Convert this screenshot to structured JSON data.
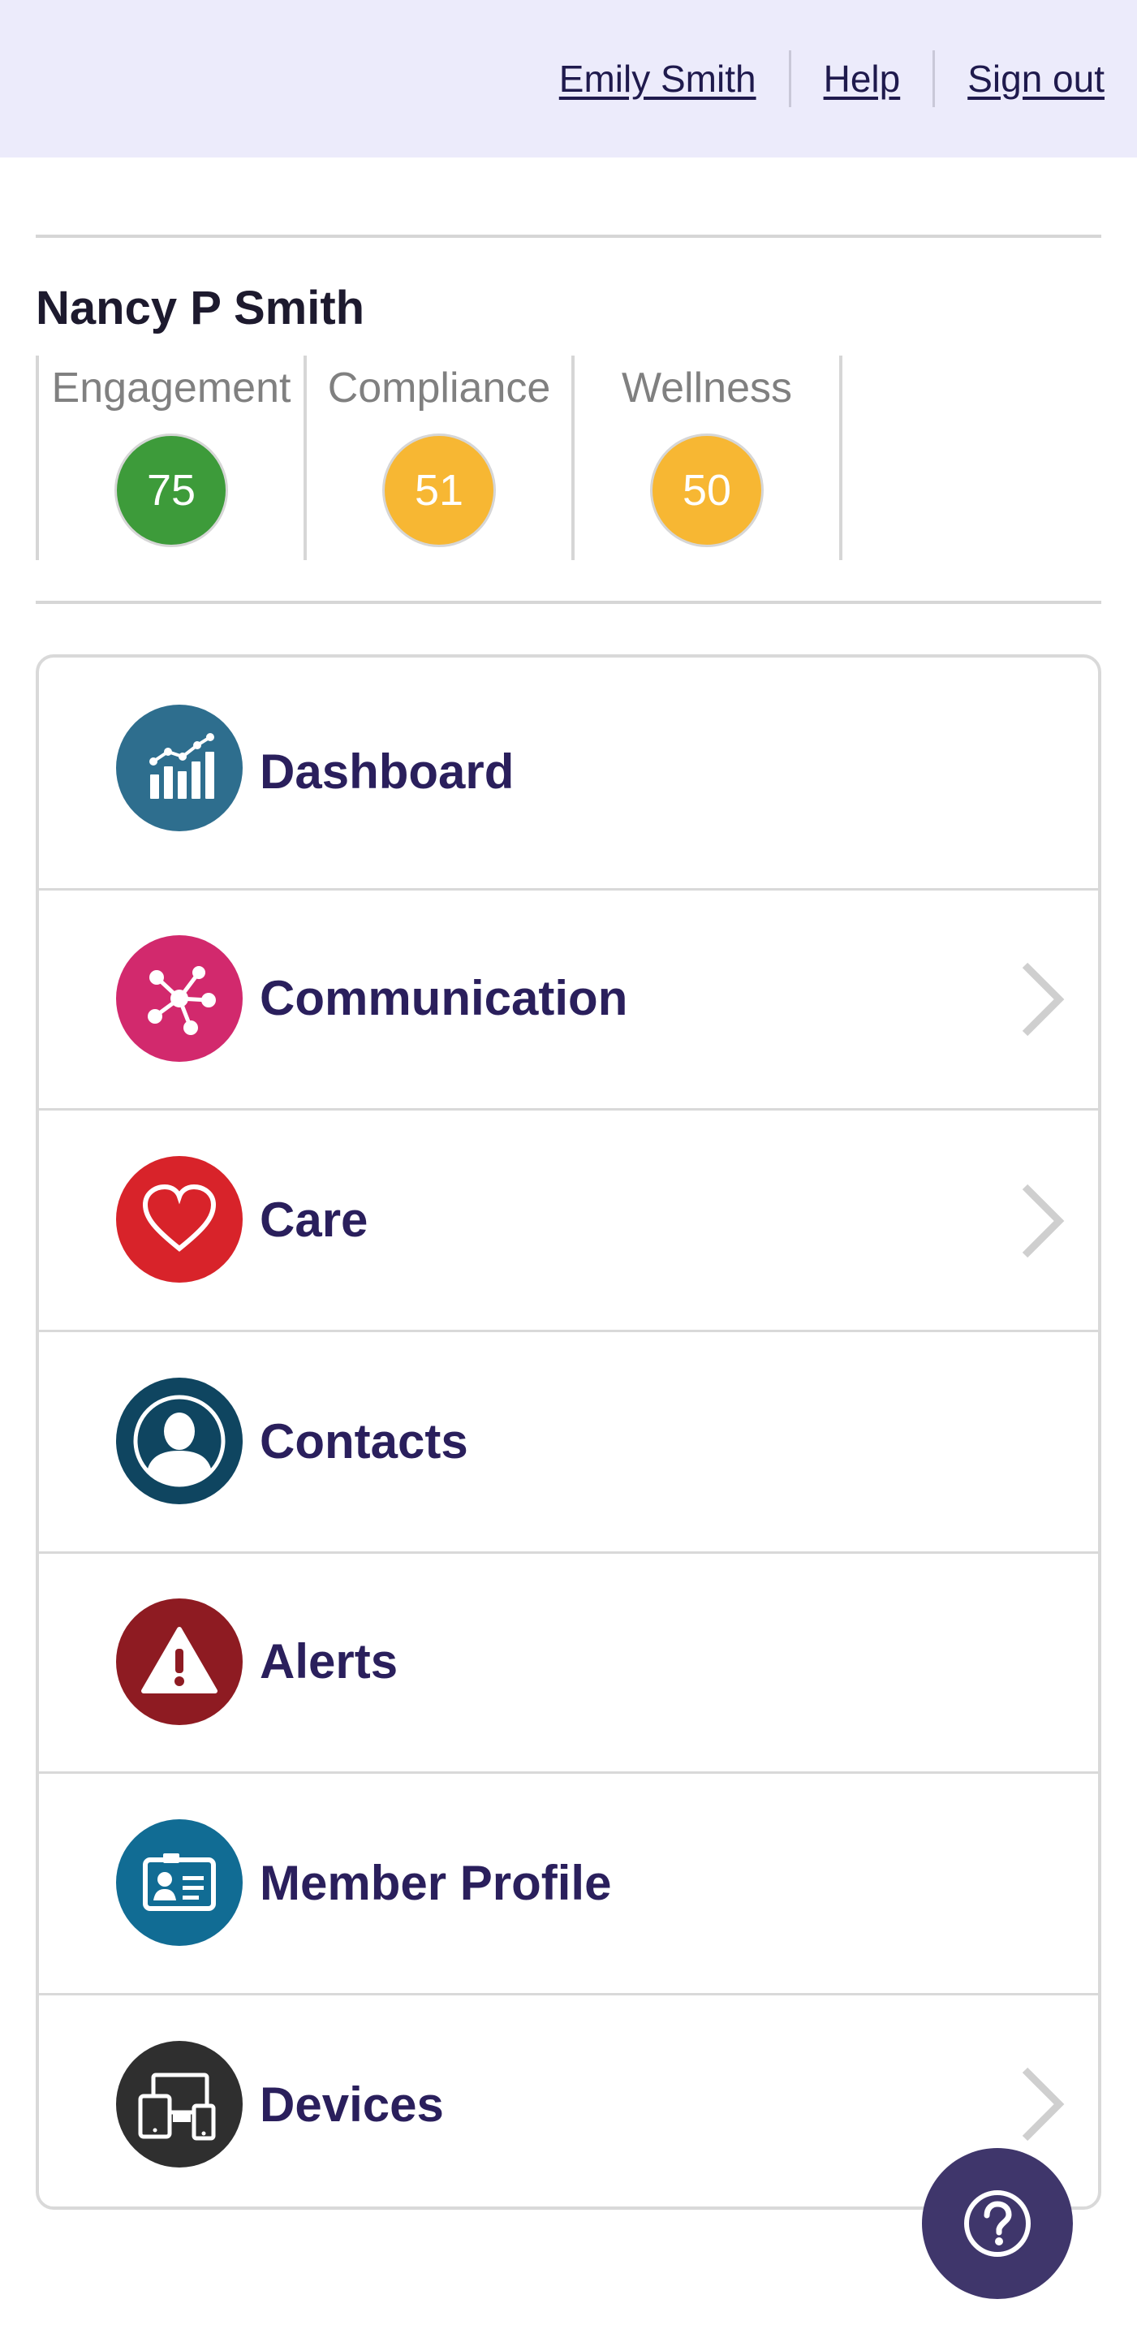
{
  "header": {
    "user_link": "Emily Smith",
    "help_link": "Help",
    "signout_link": "Sign out"
  },
  "member": {
    "name": "Nancy P Smith"
  },
  "scores": [
    {
      "label": "Engagement",
      "value": "75",
      "color": "#3d9b3a"
    },
    {
      "label": "Compliance",
      "value": "51",
      "color": "#f7b733"
    },
    {
      "label": "Wellness",
      "value": "50",
      "color": "#f7b733"
    }
  ],
  "menu": [
    {
      "label": "Dashboard",
      "icon": "dashboard-chart-icon",
      "color": "#2e6e8e",
      "has_chevron": false
    },
    {
      "label": "Communication",
      "icon": "network-hub-icon",
      "color": "#d2296d",
      "has_chevron": true
    },
    {
      "label": "Care",
      "icon": "heart-icon",
      "color": "#d8232a",
      "has_chevron": true
    },
    {
      "label": "Contacts",
      "icon": "person-icon",
      "color": "#0f4560",
      "has_chevron": false
    },
    {
      "label": "Alerts",
      "icon": "warning-triangle-icon",
      "color": "#8e1b22",
      "has_chevron": false
    },
    {
      "label": "Member Profile",
      "icon": "id-card-icon",
      "color": "#116c94",
      "has_chevron": false
    },
    {
      "label": "Devices",
      "icon": "devices-icon",
      "color": "#2f2f2f",
      "has_chevron": true
    }
  ],
  "help_button": {
    "icon": "question-icon"
  }
}
